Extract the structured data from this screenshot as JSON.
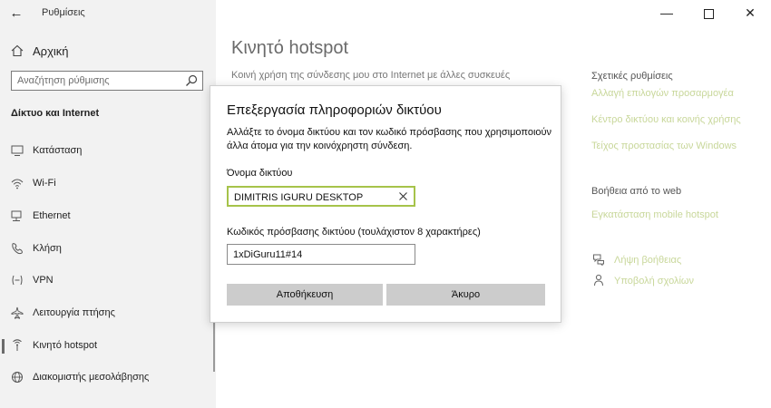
{
  "window": {
    "title": "Ρυθμίσεις",
    "back_glyph": "←",
    "minimize_glyph": "—",
    "close_glyph": "✕"
  },
  "sidebar": {
    "home_label": "Αρχική",
    "search_placeholder": "Αναζήτηση ρύθμισης",
    "section_title": "Δίκτυο και Internet",
    "items": [
      {
        "label": "Κατάσταση",
        "icon": "status-icon",
        "active": false
      },
      {
        "label": "Wi-Fi",
        "icon": "wifi-icon",
        "active": false
      },
      {
        "label": "Ethernet",
        "icon": "ethernet-icon",
        "active": false
      },
      {
        "label": "Κλήση",
        "icon": "dialup-icon",
        "active": false
      },
      {
        "label": "VPN",
        "icon": "vpn-icon",
        "active": false
      },
      {
        "label": "Λειτουργία πτήσης",
        "icon": "airplane-icon",
        "active": false
      },
      {
        "label": "Κινητό hotspot",
        "icon": "hotspot-icon",
        "active": true
      },
      {
        "label": "Διακομιστής μεσολάβησης",
        "icon": "proxy-icon",
        "active": false
      }
    ]
  },
  "main": {
    "title": "Κινητό hotspot",
    "subtitle": "Κοινή χρήση της σύνδεσης μου στο Internet με άλλες συσκευές"
  },
  "related": {
    "heading": "Σχετικές ρυθμίσεις",
    "links": [
      "Αλλαγή επιλογών προσαρμογέα",
      "Κέντρο δικτύου και κοινής χρήσης",
      "Τείχος προστασίας των Windows"
    ],
    "help_heading": "Βοήθεια από το web",
    "help_link": "Εγκατάσταση mobile hotspot",
    "get_help": "Λήψη βοήθειας",
    "feedback": "Υποβολή σχολίων"
  },
  "dialog": {
    "title": "Επεξεργασία πληροφοριών δικτύου",
    "description": "Αλλάξτε το όνομα δικτύου και τον κωδικό πρόσβασης που χρησιμοποιούν άλλα άτομα για την κοινόχρηστη σύνδεση.",
    "name_label": "Όνομα δικτύου",
    "name_value": "DIMITRIS IGURU DESKTOP",
    "password_label": "Κωδικός πρόσβασης δικτύου (τουλάχιστον 8 χαρακτήρες)",
    "password_value": "1xDiGuru11#14",
    "save_label": "Αποθήκευση",
    "cancel_label": "Άκυρο"
  },
  "colors": {
    "accent_border": "#a6c34a",
    "link": "#c8d79a",
    "sidebar_bg": "#f2f2f2",
    "button_bg": "#cccccc"
  }
}
